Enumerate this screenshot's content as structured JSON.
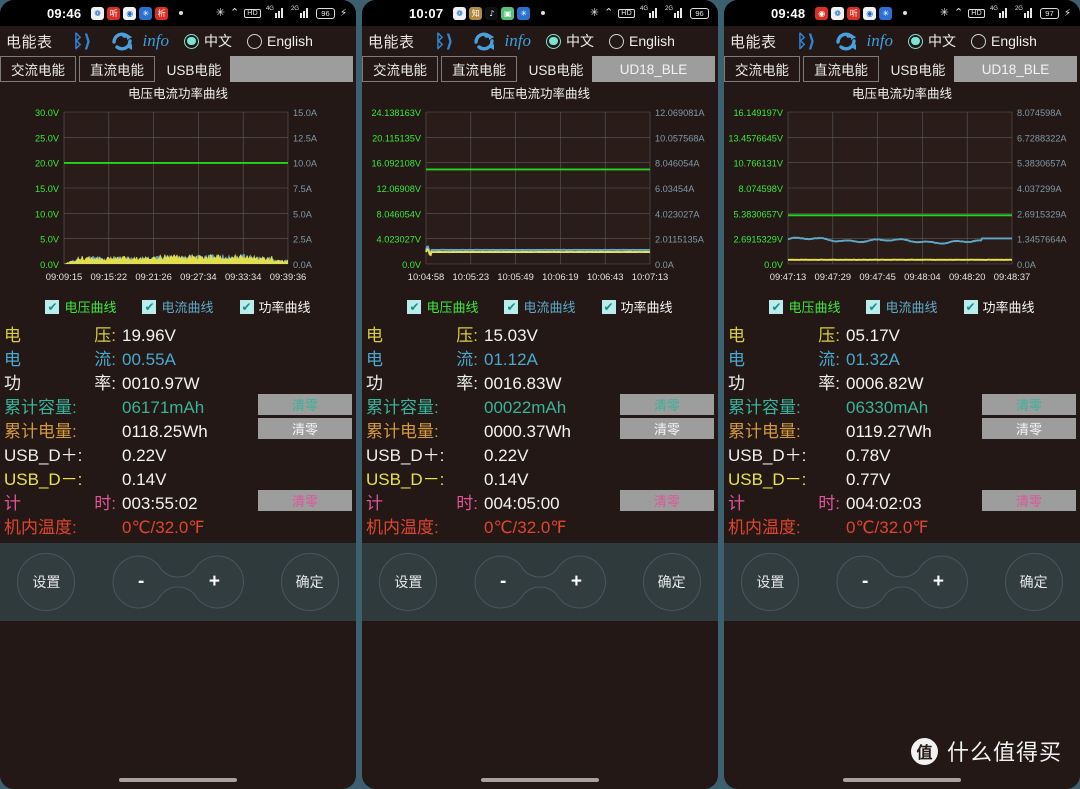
{
  "app": {
    "title": "电能表",
    "info_label": "info",
    "lang_cn": "中文",
    "lang_en": "English",
    "bt_icon": "bluetooth-icon",
    "sync_icon": "sync-icon",
    "chart_title": "电压电流功率曲线"
  },
  "tabs": {
    "ac": "交流电能",
    "dc": "直流电能",
    "usb": "USB电能",
    "ble": "UD18_BLE",
    "ble_empty": ""
  },
  "legend": {
    "voltage": "电压曲线",
    "current": "电流曲线",
    "power": "功率曲线",
    "check": "✔"
  },
  "labels": {
    "voltage": {
      "a": "电",
      "b": "压:"
    },
    "current": {
      "a": "电",
      "b": "流:"
    },
    "power": {
      "a": "功",
      "b": "率:"
    },
    "capacity": "累计容量:",
    "energy": "累计电量:",
    "usb_dp": "USB_D＋:",
    "usb_dm": "USB_D－:",
    "timer": {
      "a": "计",
      "b": "时:"
    },
    "temp": "机内温度:",
    "reset": "清零"
  },
  "controls": {
    "settings": "设置",
    "minus": "-",
    "plus": "+",
    "confirm": "确定"
  },
  "watermark": {
    "logo": "值",
    "text": "什么值得买"
  },
  "colors": {
    "voltage": "#e9e24a",
    "current": "#4aa8cf",
    "power": "#f3f3f3",
    "capacity": "#39b39a",
    "energy": "#d49a3c",
    "timer": "#e0559b",
    "temp": "#e0452f",
    "accent_green": "#3ee73e",
    "panel_bg": "#231815",
    "separator": "#3c6070"
  },
  "panels": [
    {
      "status": {
        "time": "09:46",
        "battery": "96",
        "charging": true,
        "hd": "HD",
        "net1": "4G",
        "net2": "2G"
      },
      "tab_ble": "",
      "chart_data": {
        "type": "line",
        "title": "电压电流功率曲线",
        "xlabel": "",
        "ylabel_left": "V",
        "ylabel_right": "A",
        "grid": true,
        "y_left_ticks": [
          "30.0V",
          "25.0V",
          "20.0V",
          "15.0V",
          "10.0V",
          "5.0V",
          "0.0V"
        ],
        "y_right_ticks": [
          "15.0A",
          "12.5A",
          "10.0A",
          "7.5A",
          "5.0A",
          "2.5A",
          "0.0A"
        ],
        "ylim_left": [
          0,
          30
        ],
        "ylim_right": [
          0,
          15
        ],
        "x_ticks": [
          "09:09:15",
          "09:15:22",
          "09:21:26",
          "09:27:34",
          "09:33:34",
          "09:39:36"
        ],
        "series": [
          {
            "name": "电压曲线",
            "color": "#22d422",
            "style": "flat",
            "level": 19.96,
            "axis": "left"
          },
          {
            "name": "电流曲线",
            "color": "#5ea8c9",
            "style": "noisy",
            "level": 0.55,
            "noise": 0.9,
            "axis": "right"
          },
          {
            "name": "功率曲线",
            "color": "#e9e24a",
            "style": "noisy",
            "level": 1.3,
            "noise": 0.7,
            "axis": "left"
          }
        ]
      },
      "readout": {
        "voltage": "19.96V",
        "current": "00.55A",
        "power": "0010.97W",
        "capacity": "06171mAh",
        "energy": "0118.25Wh",
        "usb_dp": "0.22V",
        "usb_dm": "0.14V",
        "timer": "003:55:02",
        "temp": "0℃/32.0℉"
      }
    },
    {
      "status": {
        "time": "10:07",
        "battery": "96",
        "charging": false,
        "hd": "HD",
        "net1": "4G",
        "net2": "2G"
      },
      "tab_ble": "UD18_BLE",
      "chart_data": {
        "type": "line",
        "title": "电压电流功率曲线",
        "xlabel": "",
        "ylabel_left": "V",
        "ylabel_right": "A",
        "grid": true,
        "y_left_ticks": [
          "24.138163V",
          "20.115135V",
          "16.092108V",
          "12.06908V",
          "8.046054V",
          "4.023027V",
          "0.0V"
        ],
        "y_right_ticks": [
          "12.069081A",
          "10.057568A",
          "8.046054A",
          "6.03454A",
          "4.023027A",
          "2.0115135A",
          "0.0A"
        ],
        "ylim_left": [
          0,
          24.138163
        ],
        "ylim_right": [
          0,
          12.069081
        ],
        "x_ticks": [
          "10:04:58",
          "10:05:23",
          "10:05:49",
          "10:06:19",
          "10:06:43",
          "10:07:13"
        ],
        "series": [
          {
            "name": "电压曲线",
            "color": "#22d422",
            "style": "flat",
            "level": 15.03,
            "axis": "left"
          },
          {
            "name": "电流曲线",
            "color": "#5ea8c9",
            "style": "smooth",
            "level": 1.12,
            "axis": "right"
          },
          {
            "name": "功率曲线",
            "color": "#e9e24a",
            "style": "smooth",
            "level": 1.9,
            "axis": "left"
          }
        ]
      },
      "readout": {
        "voltage": "15.03V",
        "current": "01.12A",
        "power": "0016.83W",
        "capacity": "00022mAh",
        "energy": "0000.37Wh",
        "usb_dp": "0.22V",
        "usb_dm": "0.14V",
        "timer": "004:05:00",
        "temp": "0℃/32.0℉"
      }
    },
    {
      "status": {
        "time": "09:48",
        "battery": "97",
        "charging": true,
        "hd": "HD",
        "net1": "4G",
        "net2": "2G"
      },
      "tab_ble": "UD18_BLE",
      "chart_data": {
        "type": "line",
        "title": "电压电流功率曲线",
        "xlabel": "",
        "ylabel_left": "V",
        "ylabel_right": "A",
        "grid": true,
        "y_left_ticks": [
          "16.149197V",
          "13.4576645V",
          "10.766131V",
          "8.074598V",
          "5.3830657V",
          "2.6915329V",
          "0.0V"
        ],
        "y_right_ticks": [
          "8.074598A",
          "6.7288322A",
          "5.3830657A",
          "4.037299A",
          "2.6915329A",
          "1.3457664A",
          "0.0A"
        ],
        "ylim_left": [
          0,
          16.149197
        ],
        "ylim_right": [
          0,
          8.074598
        ],
        "x_ticks": [
          "09:47:13",
          "09:47:29",
          "09:47:45",
          "09:48:04",
          "09:48:20",
          "09:48:37"
        ],
        "series": [
          {
            "name": "电压曲线",
            "color": "#22d422",
            "style": "flat",
            "level": 5.17,
            "axis": "left"
          },
          {
            "name": "电流曲线",
            "color": "#5ea8c9",
            "style": "wavy",
            "level": 1.32,
            "axis": "right"
          },
          {
            "name": "功率曲线",
            "color": "#e9e24a",
            "style": "lowflat",
            "level": 0.45,
            "axis": "left"
          }
        ]
      },
      "readout": {
        "voltage": "05.17V",
        "current": "01.32A",
        "power": "0006.82W",
        "capacity": "06330mAh",
        "energy": "0119.27Wh",
        "usb_dp": "0.78V",
        "usb_dm": "0.77V",
        "timer": "004:02:03",
        "temp": "0℃/32.0℉"
      }
    }
  ]
}
